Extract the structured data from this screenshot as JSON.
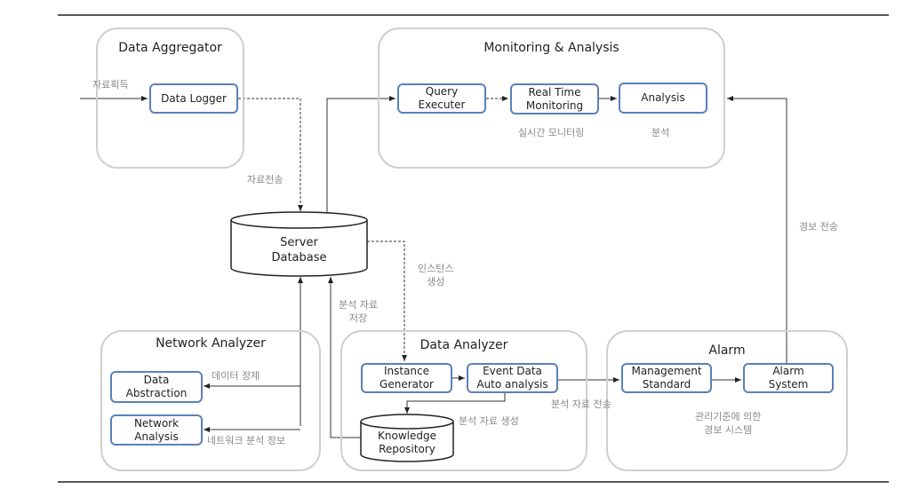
{
  "groups": {
    "data_aggregator": "Data Aggregator",
    "monitoring": "Monitoring & Analysis",
    "network_analyzer": "Network Analyzer",
    "data_analyzer": "Data Analyzer",
    "alarm": "Alarm"
  },
  "nodes": {
    "data_logger": "Data Logger",
    "query_executer": "Query\nExecuter",
    "real_time_monitoring": "Real Time\nMonitoring",
    "analysis": "Analysis",
    "server_database": "Server\nDatabase",
    "data_abstraction": "Data\nAbstraction",
    "network_analysis": "Network\nAnalysis",
    "instance_generator": "Instance\nGenerator",
    "event_data": "Event Data\nAuto analysis",
    "knowledge_repository": "Knowledge\nRepository",
    "management_standard": "Management\nStandard",
    "alarm_system": "Alarm\nSystem"
  },
  "labels": {
    "acquire": "자료획득",
    "transfer": "자료전송",
    "realtime": "실시간 모니터링",
    "analysis_kr": "분석",
    "alarm_send": "경보 전송",
    "instance_create": "인스턴스\n생성",
    "analysis_store": "분석 자료\n저장",
    "data_cleanse": "데이터 정제",
    "network_info": "네트워크 분석 정보",
    "analysis_generate": "분석 자료 생성",
    "analysis_send": "분석 자료 전송",
    "alarm_by_standard": "관리기준에 의한\n경보 시스템"
  },
  "colors": {
    "node_border": "#5b80b8",
    "group_border": "#cfcfcf",
    "label": "#8a8a8a"
  }
}
